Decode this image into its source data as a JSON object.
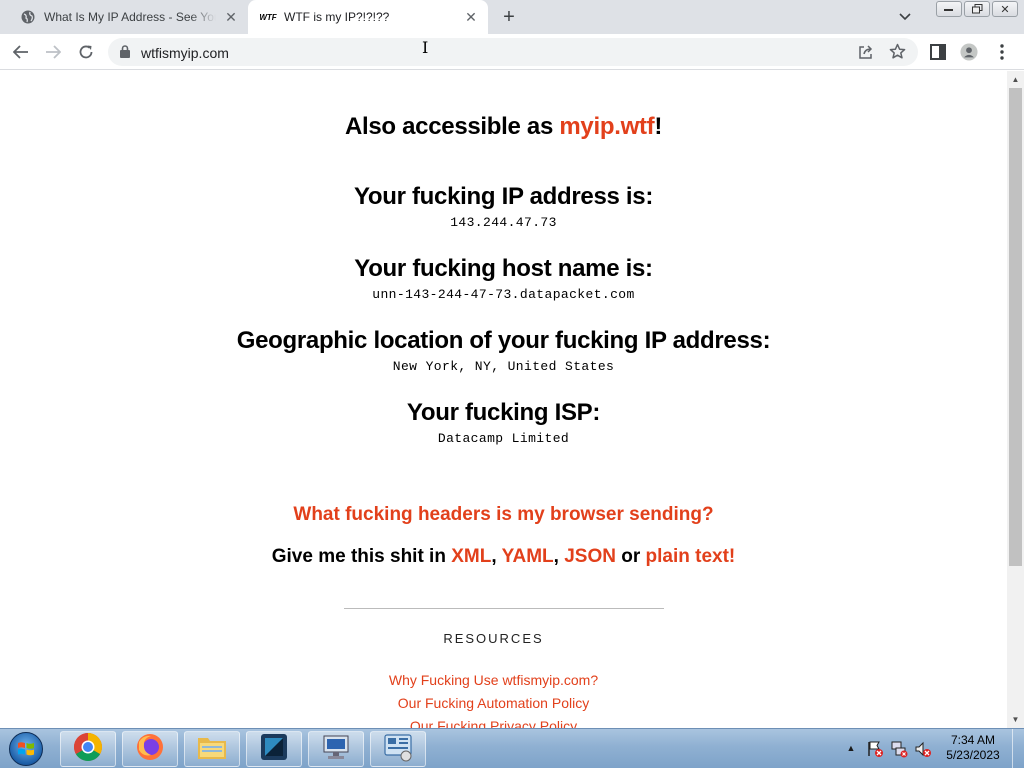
{
  "browser": {
    "tabs": [
      {
        "title": "What Is My IP Address - See Your"
      },
      {
        "title": "WTF is my IP?!?!??",
        "favicon_text": "WTF"
      }
    ],
    "url": "wtfismyip.com"
  },
  "page": {
    "accessible": {
      "prefix": "Also accessible as ",
      "link": "myip.wtf",
      "suffix": "!"
    },
    "ip": {
      "heading": "Your fucking IP address is:",
      "value": "143.244.47.73"
    },
    "host": {
      "heading": "Your fucking host name is:",
      "value": "unn-143-244-47-73.datapacket.com"
    },
    "geo": {
      "heading": "Geographic location of your fucking IP address:",
      "value": "New York, NY, United States"
    },
    "isp": {
      "heading": "Your fucking ISP:",
      "value": "Datacamp Limited"
    },
    "headers_link": "What fucking headers is my browser sending?",
    "formats": {
      "prefix": "Give me this shit in ",
      "xml": "XML",
      "sep1": ", ",
      "yaml": "YAML",
      "sep2": ", ",
      "json": "JSON",
      "or": " or ",
      "plain": "plain text!"
    },
    "resources": {
      "heading": "RESOURCES",
      "links": [
        "Why Fucking Use wtfismyip.com?",
        "Our Fucking Automation Policy",
        "Our Fucking Privacy Policy"
      ]
    }
  },
  "taskbar": {
    "time": "7:34 AM",
    "date": "5/23/2023",
    "apps": [
      "chrome-icon",
      "firefox-icon",
      "explorer-icon",
      "app-icon",
      "network-app-icon",
      "control-panel-icon"
    ]
  },
  "colors": {
    "accent": "#e2401b",
    "tabstrip": "#dee1e6"
  }
}
